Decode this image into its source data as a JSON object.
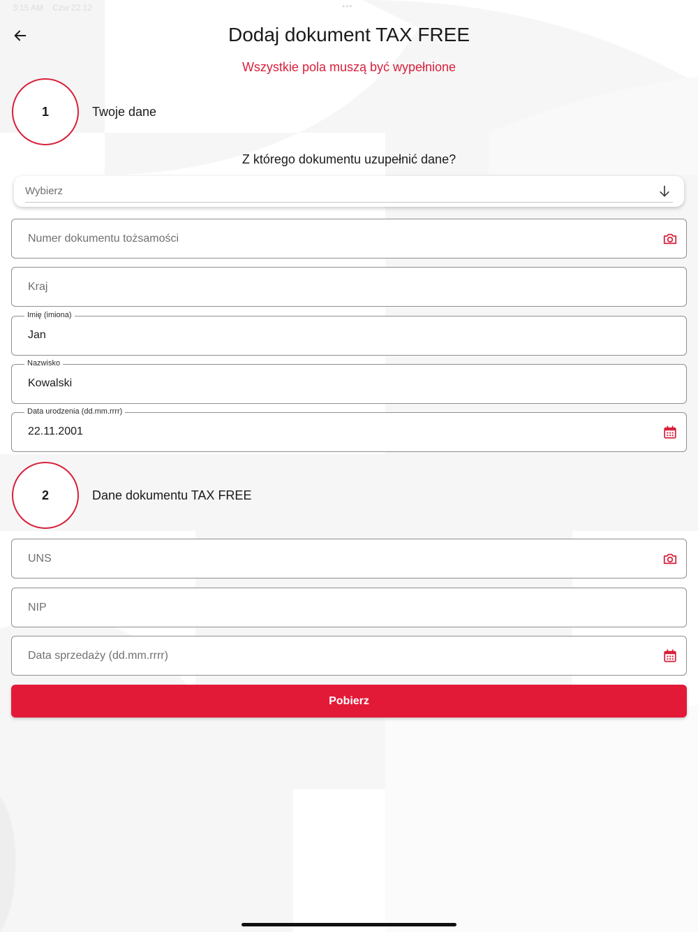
{
  "status_bar": {
    "time": "3:15 AM",
    "date": "Czw 22.12",
    "dots": "•••"
  },
  "header": {
    "back_icon": "arrow-left-icon",
    "title": "Dodaj dokument TAX FREE"
  },
  "warning": "Wszystkie pola muszą być wypełnione",
  "steps": [
    {
      "number": "1",
      "label": "Twoje dane"
    },
    {
      "number": "2",
      "label": "Dane dokumentu TAX FREE"
    }
  ],
  "section1": {
    "question": "Z którego dokumentu uzupełnić dane?",
    "select": {
      "value": "Wybierz",
      "icon": "arrow-down-icon"
    },
    "fields": {
      "id_number": {
        "placeholder": "Numer dokumentu tożsamości",
        "icon": "camera-icon"
      },
      "country": {
        "placeholder": "Kraj"
      },
      "first_name": {
        "label": "Imię (imiona)",
        "value": "Jan"
      },
      "last_name": {
        "label": "Nazwisko",
        "value": "Kowalski"
      },
      "birth_date": {
        "label": "Data urodzenia (dd.mm.rrrr)",
        "value": "22.11.2001",
        "icon": "calendar-icon"
      }
    }
  },
  "section2": {
    "fields": {
      "uns": {
        "placeholder": "UNS",
        "icon": "camera-icon"
      },
      "nip": {
        "placeholder": "NIP"
      },
      "sale_date": {
        "placeholder": "Data sprzedaży (dd.mm.rrrr)",
        "icon": "calendar-icon"
      }
    }
  },
  "submit_button": {
    "label": "Pobierz"
  },
  "colors": {
    "accent": "#e21a38",
    "text": "#1a1a1a",
    "border": "#8e8e8e",
    "background_shape": "#f4f4f4"
  }
}
